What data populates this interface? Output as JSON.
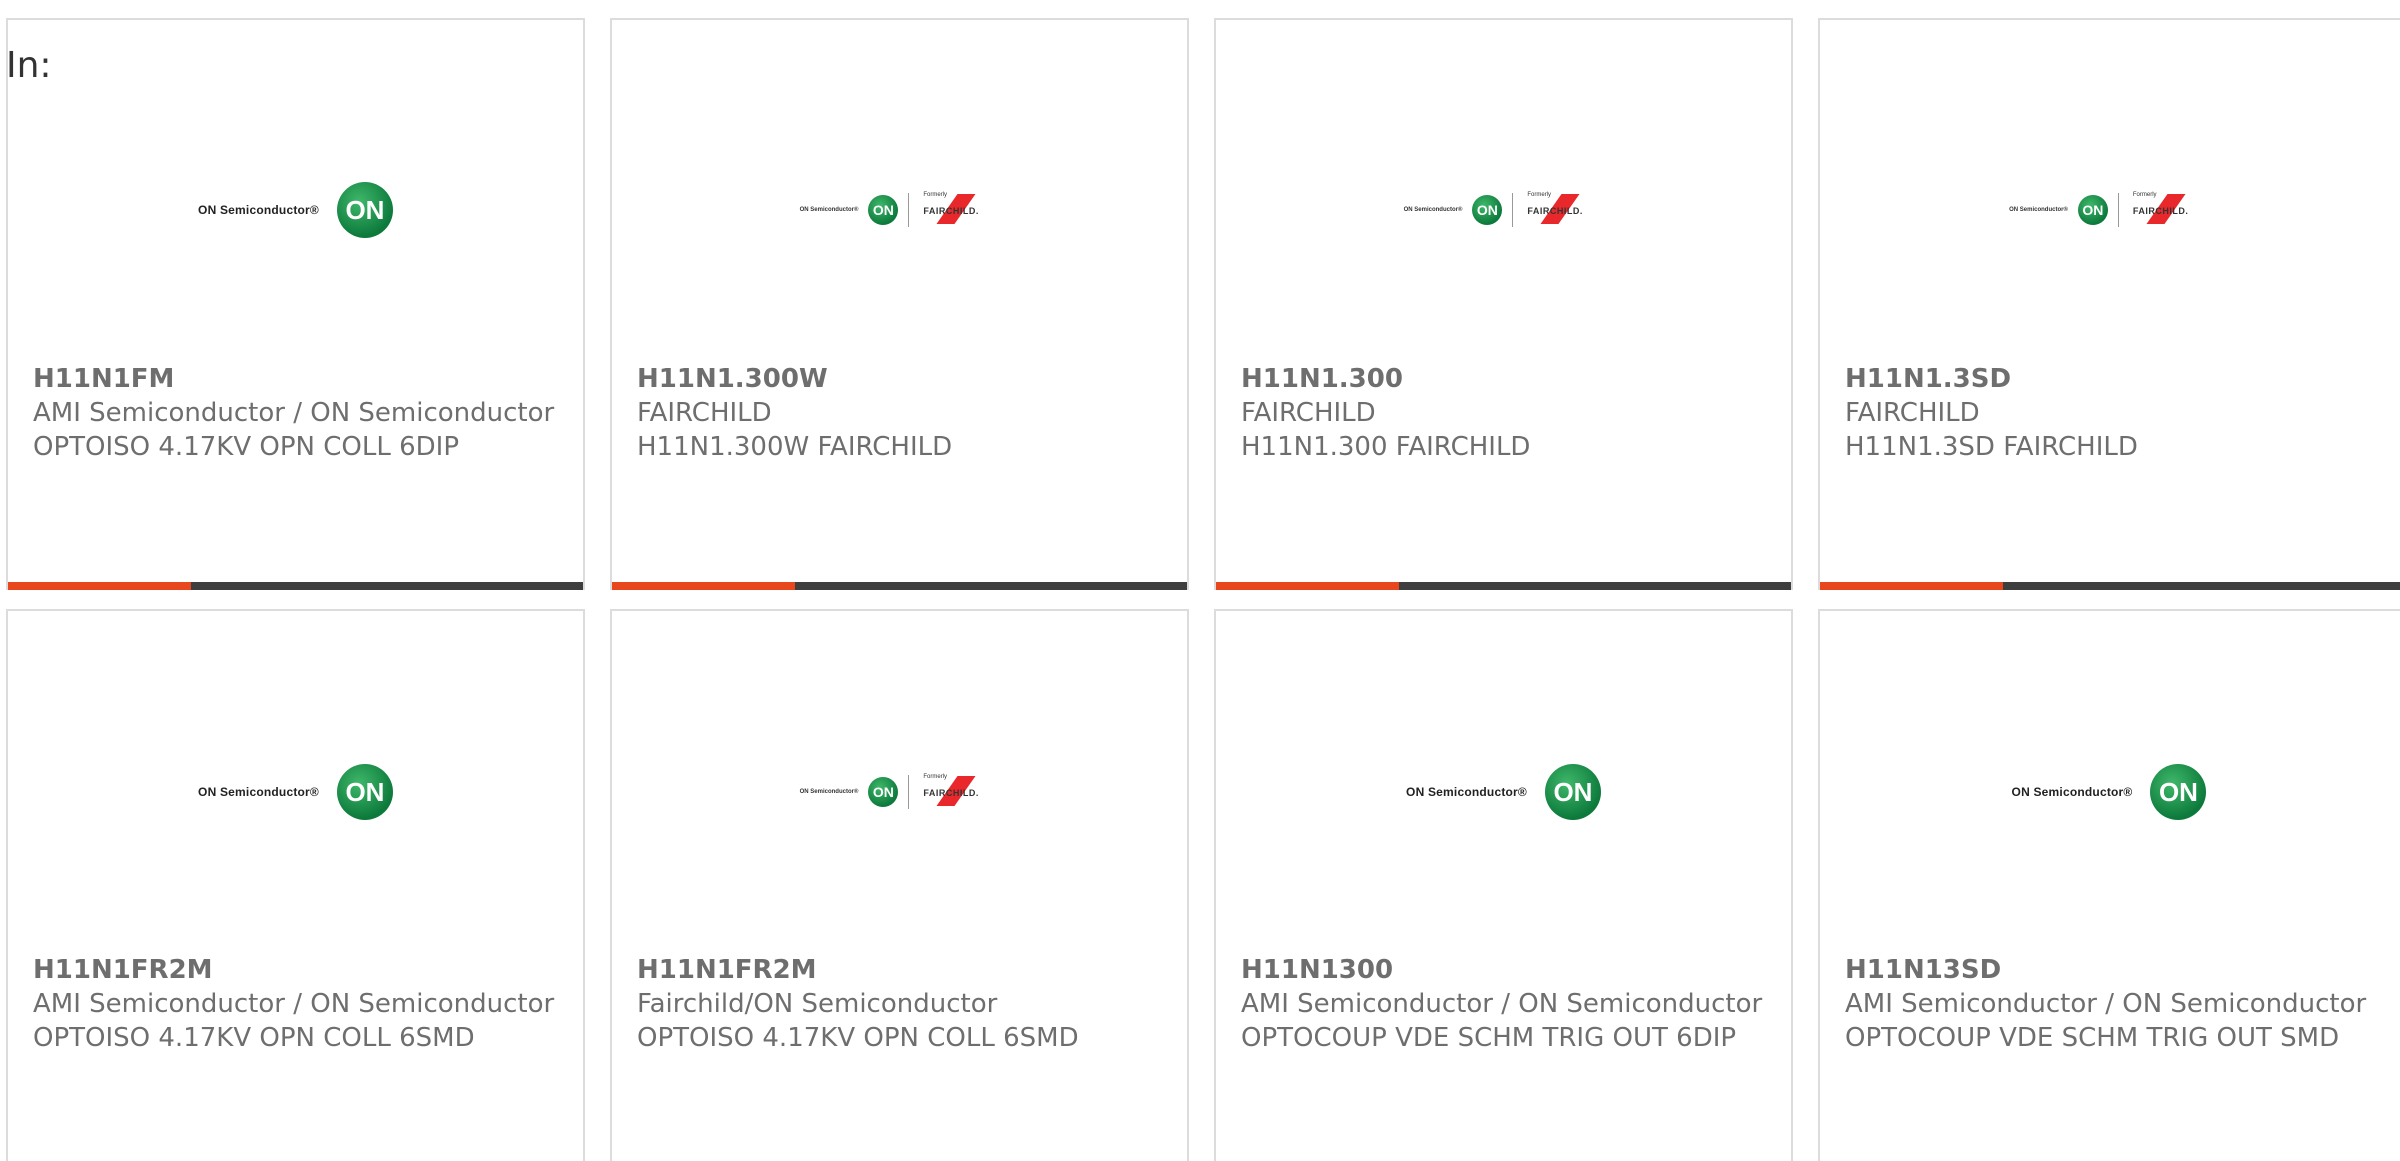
{
  "filter_label": "In:",
  "products": [
    {
      "part": "H11N1FM",
      "manufacturer": "AMI Semiconductor / ON Semiconductor",
      "description": "OPTOISO 4.17KV OPN COLL 6DIP",
      "logo": "on-semiconductor-logo"
    },
    {
      "part": "H11N1.300W",
      "manufacturer": "FAIRCHILD",
      "description": "H11N1.300W FAIRCHILD",
      "logo": "on-semiconductor-formerly-fairchild-logo"
    },
    {
      "part": "H11N1.300",
      "manufacturer": "FAIRCHILD",
      "description": "H11N1.300 FAIRCHILD",
      "logo": "on-semiconductor-formerly-fairchild-logo"
    },
    {
      "part": "H11N1.3SD",
      "manufacturer": "FAIRCHILD",
      "description": "H11N1.3SD FAIRCHILD",
      "logo": "on-semiconductor-formerly-fairchild-logo"
    },
    {
      "part": "H11N1FR2M",
      "manufacturer": "AMI Semiconductor / ON Semiconductor",
      "description": "OPTOISO 4.17KV OPN COLL 6SMD",
      "logo": "on-semiconductor-logo"
    },
    {
      "part": "H11N1FR2M",
      "manufacturer": "Fairchild/ON Semiconductor",
      "description": "OPTOISO 4.17KV OPN COLL 6SMD",
      "logo": "on-semiconductor-formerly-fairchild-logo"
    },
    {
      "part": "H11N1300",
      "manufacturer": "AMI Semiconductor / ON Semiconductor",
      "description": "OPTOCOUP VDE SCHM TRIG OUT 6DIP",
      "logo": "on-semiconductor-logo"
    },
    {
      "part": "H11N13SD",
      "manufacturer": "AMI Semiconductor / ON Semiconductor",
      "description": "OPTOCOUP VDE SCHM TRIG OUT SMD",
      "logo": "on-semiconductor-logo"
    }
  ],
  "logo_text": {
    "on_semiconductor": "ON Semiconductor®",
    "on_badge": "ON",
    "formerly": "Formerly",
    "fairchild": "FAIRCHILD."
  },
  "colors": {
    "accent_bar": "#e8461c",
    "dark_bar": "#3e3e3e",
    "on_green": "#0d7a3c",
    "fairchild_red": "#e8282b"
  }
}
